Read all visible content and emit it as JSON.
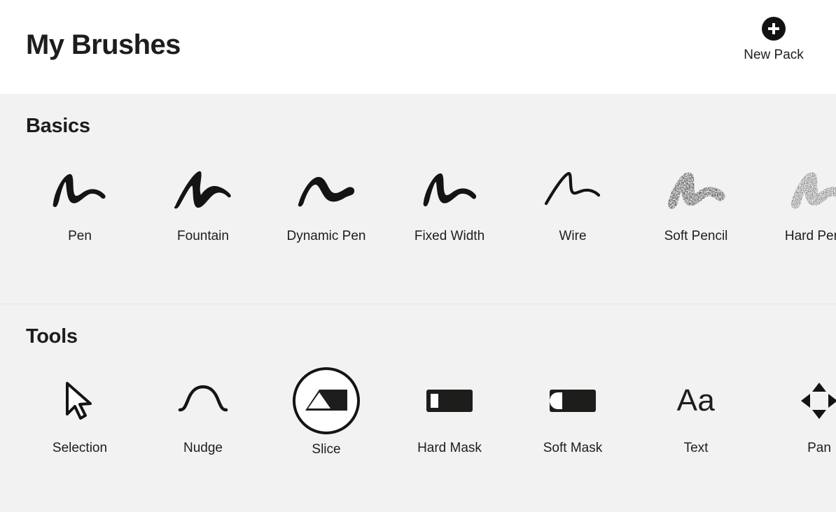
{
  "header": {
    "title": "My Brushes",
    "new_pack": {
      "label": "New Pack",
      "icon": "plus-circle-icon"
    }
  },
  "colors": {
    "header_background": "#ffffff",
    "page_background": "#f2f2f2",
    "ink": "#1d1d1b",
    "divider": "#e6e6e6",
    "selection_ring": "#141414"
  },
  "sections": [
    {
      "id": "basics",
      "title": "Basics",
      "items": [
        {
          "label": "Pen",
          "icon": "brush-stroke-pen-icon",
          "selected": false
        },
        {
          "label": "Fountain",
          "icon": "brush-stroke-fountain-icon",
          "selected": false
        },
        {
          "label": "Dynamic Pen",
          "icon": "brush-stroke-dynamic-pen-icon",
          "selected": false
        },
        {
          "label": "Fixed Width",
          "icon": "brush-stroke-fixed-width-icon",
          "selected": false
        },
        {
          "label": "Wire",
          "icon": "brush-stroke-wire-icon",
          "selected": false
        },
        {
          "label": "Soft Pencil",
          "icon": "brush-stroke-soft-pencil-icon",
          "selected": false
        },
        {
          "label": "Hard Pencil",
          "icon": "brush-stroke-hard-pencil-icon",
          "selected": false
        }
      ]
    },
    {
      "id": "tools",
      "title": "Tools",
      "items": [
        {
          "label": "Selection",
          "icon": "cursor-arrow-icon",
          "selected": false
        },
        {
          "label": "Nudge",
          "icon": "wave-curve-icon",
          "selected": false
        },
        {
          "label": "Slice",
          "icon": "slice-shape-icon",
          "selected": true
        },
        {
          "label": "Hard Mask",
          "icon": "hard-mask-icon",
          "selected": false
        },
        {
          "label": "Soft Mask",
          "icon": "soft-mask-icon",
          "selected": false
        },
        {
          "label": "Text",
          "icon": "text-aa-icon",
          "selected": false
        },
        {
          "label": "Pan",
          "icon": "pan-arrows-icon",
          "selected": false
        }
      ]
    }
  ]
}
